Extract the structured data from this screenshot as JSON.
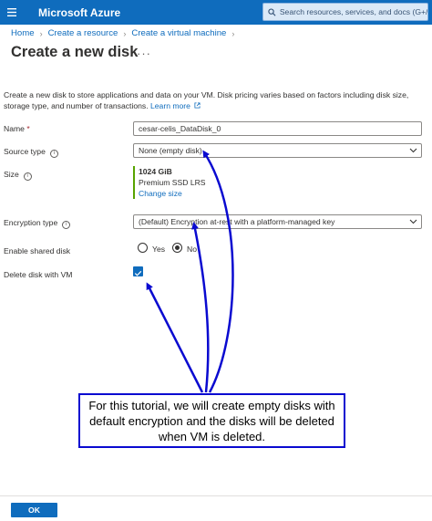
{
  "header": {
    "brand": "Microsoft Azure",
    "search_placeholder": "Search resources, services, and docs (G+/)"
  },
  "breadcrumb": [
    "Home",
    "Create a resource",
    "Create a virtual machine"
  ],
  "page": {
    "title": "Create a new disk",
    "more": "···"
  },
  "description": {
    "text": "Create a new disk to store applications and data on your VM. Disk pricing varies based on factors including disk size, storage type, and number of transactions.",
    "link": "Learn more"
  },
  "form": {
    "name": {
      "label": "Name",
      "value": "cesar-celis_DataDisk_0"
    },
    "source_type": {
      "label": "Source type",
      "value": "None (empty disk)"
    },
    "size": {
      "label": "Size",
      "amount": "1024 GiB",
      "tier": "Premium SSD LRS",
      "change": "Change size"
    },
    "encryption": {
      "label": "Encryption type",
      "value": "(Default) Encryption at-rest with a platform-managed key"
    },
    "shared": {
      "label": "Enable shared disk",
      "yes": "Yes",
      "no": "No",
      "selected": "No"
    },
    "delete_with_vm": {
      "label": "Delete disk with VM",
      "checked": true
    }
  },
  "callout": {
    "text": "For this tutorial, we will create empty disks with default encryption and the disks will be deleted when VM is deleted."
  },
  "footer": {
    "ok": "OK"
  },
  "colors": {
    "brand": "#0f6cbd",
    "callout": "#0a0ad0",
    "size_accent": "#57a300"
  }
}
